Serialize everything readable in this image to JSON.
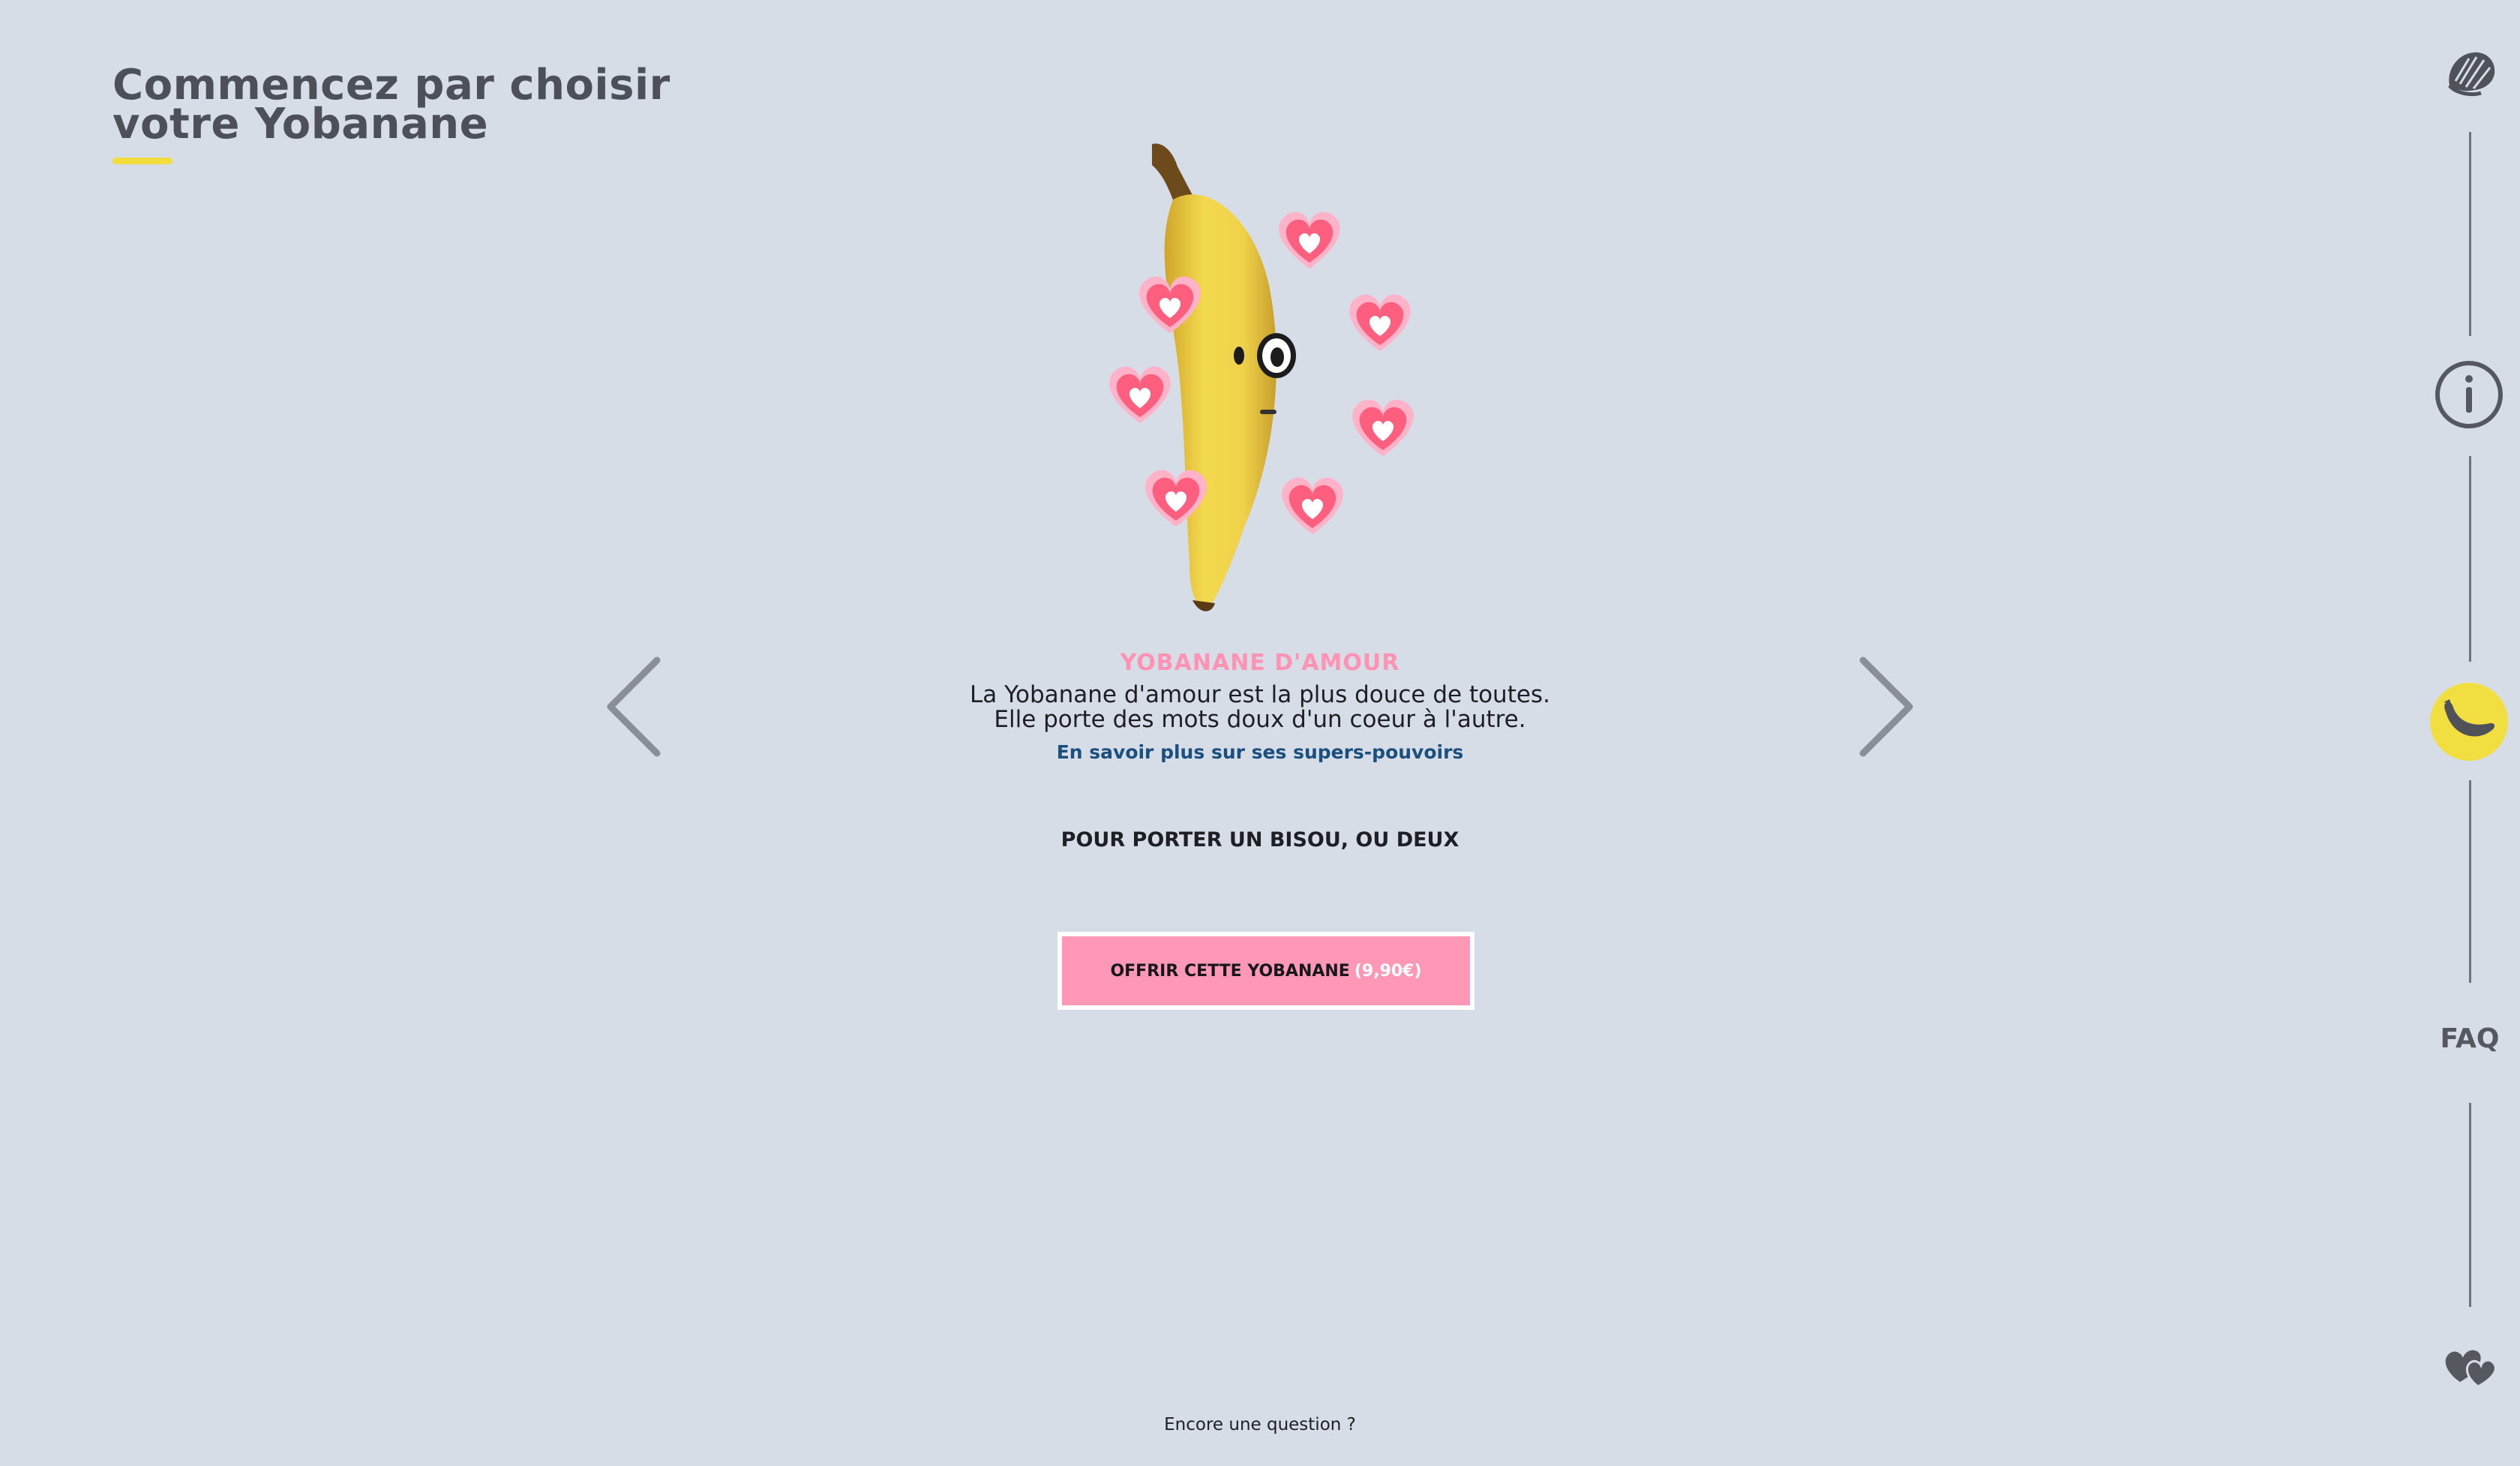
{
  "header": {
    "title_line1": "Commencez par choisir",
    "title_line2": "votre Yobanane"
  },
  "product": {
    "name": "YOBANANE D'AMOUR",
    "description_line1": "La Yobanane d'amour est la plus douce de toutes.",
    "description_line2": "Elle porte des mots doux d'un coeur à l'autre.",
    "learn_more": "En savoir plus sur ses supers-pouvoirs",
    "tagline": "POUR PORTER UN BISOU, OU DEUX",
    "cta_label": "OFFRIR CETTE YOBANANE",
    "cta_price": "(9,90€)"
  },
  "nav": {
    "faq_label": "FAQ",
    "icons": [
      "shell-icon",
      "info-icon",
      "banana-icon",
      "hearts-icon"
    ]
  },
  "footer": {
    "question": "Encore une question ?"
  },
  "colors": {
    "background": "#d7dde7",
    "accent_yellow": "#f1dd3e",
    "accent_pink": "#ff98b6",
    "link_blue": "#1b4f7e",
    "heading_gray": "#4d5058"
  }
}
